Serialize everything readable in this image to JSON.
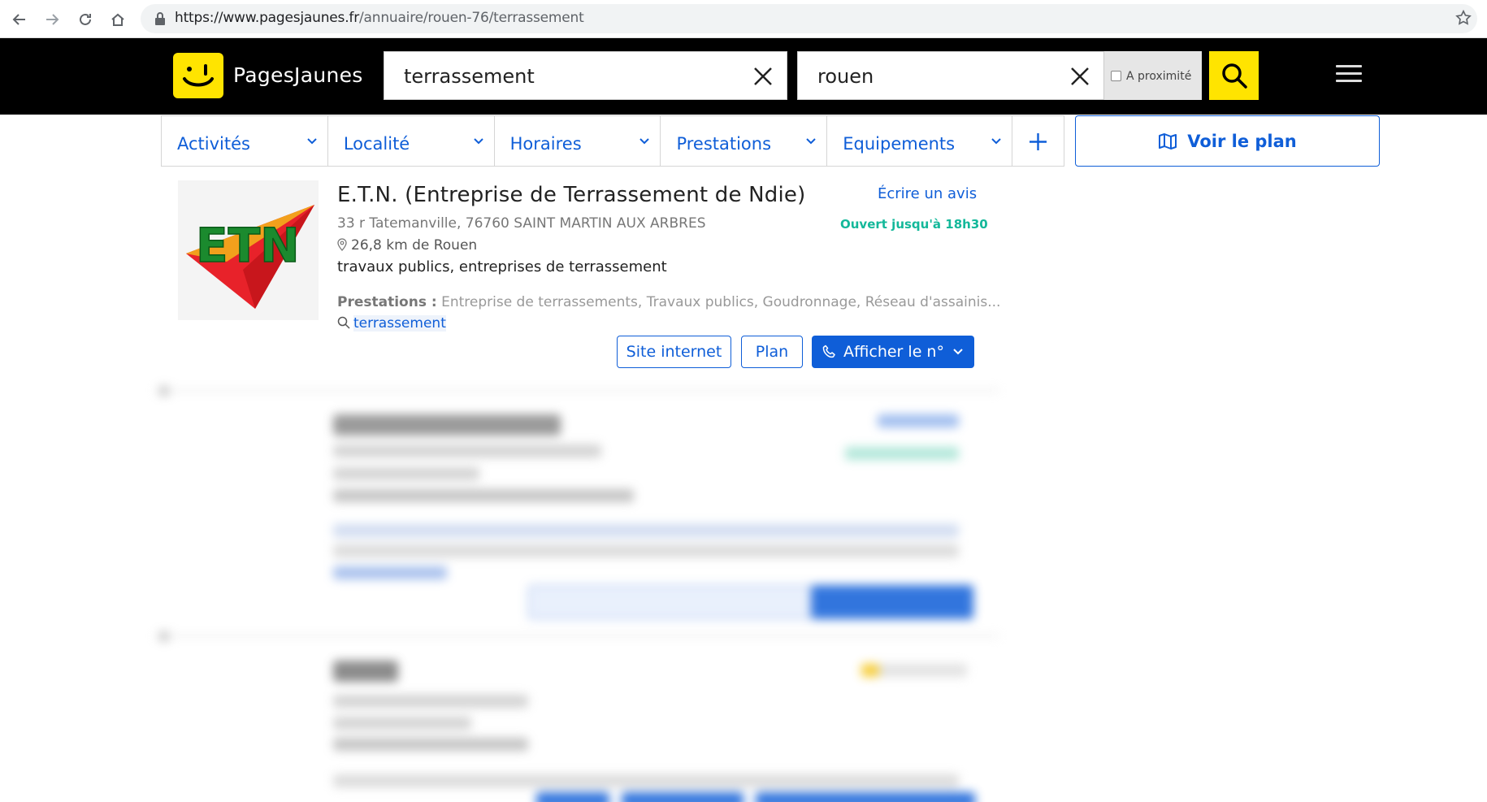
{
  "browser": {
    "url_host": "https://www.pagesjaunes.fr",
    "url_path": "/annuaire/rouen-76/terrassement"
  },
  "header": {
    "logo_text": "PagesJaunes",
    "what_value": "terrassement",
    "where_value": "rouen",
    "proximite_label": "A proximité"
  },
  "filters": {
    "items": [
      {
        "label": "Activités"
      },
      {
        "label": "Localité"
      },
      {
        "label": "Horaires"
      },
      {
        "label": "Prestations"
      },
      {
        "label": "Equipements"
      }
    ],
    "voir_plan": "Voir le plan"
  },
  "listing": {
    "name": "E.T.N. (Entreprise de Terrassement de Ndie)",
    "logo_text": "ETN",
    "address": "33 r Tatemanville, 76760 SAINT MARTIN AUX ARBRES",
    "distance": "26,8 km de Rouen",
    "categories": "travaux publics,  entreprises de terrassement",
    "prestations_label": "Prestations :",
    "prestations": " Entreprise de terrassements, Travaux publics, Goudronnage, Réseau d'assainis...",
    "tag": "terrassement",
    "write_review": "Écrire un avis",
    "open_status": "Ouvert jusqu'à 18h30",
    "btn_site": "Site internet",
    "btn_plan": "Plan",
    "btn_phone": "Afficher le n°"
  },
  "colors": {
    "brand_yellow": "#ffe400",
    "link_blue": "#0f5ed8",
    "open_green": "#13b89a"
  }
}
